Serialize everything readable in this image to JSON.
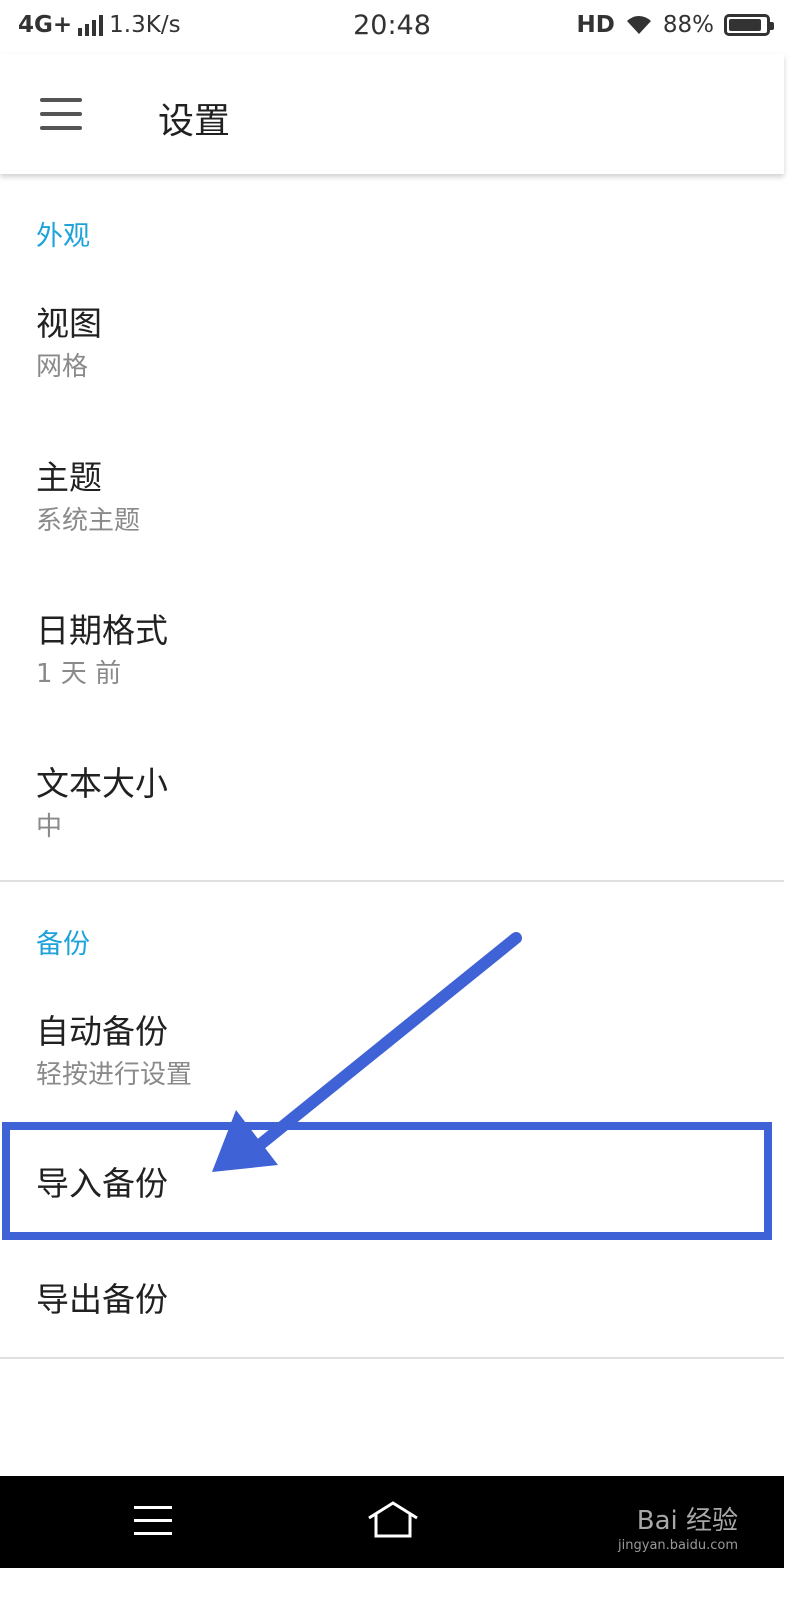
{
  "status_bar": {
    "network": "4G+",
    "speed": "1.3K/s",
    "time": "20:48",
    "hd": "HD",
    "battery": "88%",
    "battery_level": 0.88
  },
  "app_bar": {
    "title": "设置",
    "menu_icon": "hamburger-menu-icon"
  },
  "sections": {
    "appearance": {
      "header": "外观",
      "items": [
        {
          "title": "视图",
          "subtitle": "网格"
        },
        {
          "title": "主题",
          "subtitle": "系统主题"
        },
        {
          "title": "日期格式",
          "subtitle": "1 天 前"
        },
        {
          "title": "文本大小",
          "subtitle": "中"
        }
      ]
    },
    "backup": {
      "header": "备份",
      "items": [
        {
          "title": "自动备份",
          "subtitle": "轻按进行设置"
        },
        {
          "title": "导入备份"
        },
        {
          "title": "导出备份"
        }
      ]
    }
  },
  "annotation": {
    "color": "#3f63d6"
  },
  "nav_bar": {
    "watermark": "Bai 经验",
    "watermark_url": "jingyan.baidu.com"
  },
  "colors": {
    "accent": "#1ea2db",
    "primary_text": "#212121",
    "secondary_text": "#8a8a8a"
  }
}
